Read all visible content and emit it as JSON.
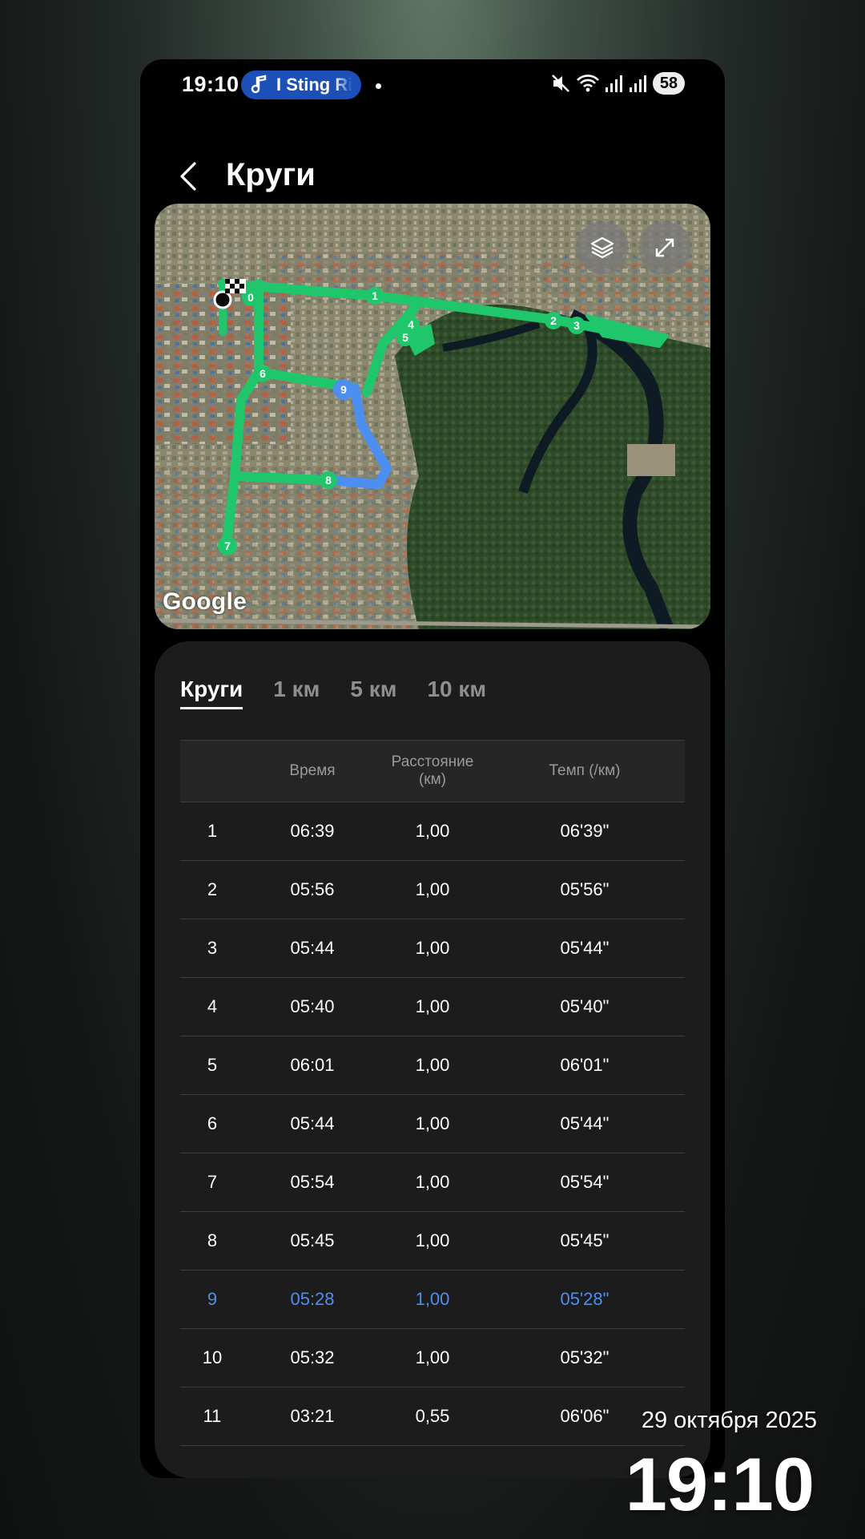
{
  "status_bar": {
    "time": "19:10",
    "media_text": "I Sting Ri",
    "battery": "58",
    "icons": [
      "mute-icon",
      "wifi-icon",
      "signal-icon",
      "signal-icon"
    ]
  },
  "header": {
    "title": "Круги"
  },
  "map": {
    "logo": "Google",
    "route_color": "#1fc66b",
    "highlight_color": "#4d8ff0",
    "markers": [
      "0",
      "1",
      "2",
      "3",
      "4",
      "5",
      "6",
      "7",
      "8",
      "9"
    ]
  },
  "tabs": [
    {
      "label": "Круги",
      "active": true
    },
    {
      "label": "1 км",
      "active": false
    },
    {
      "label": "5 км",
      "active": false
    },
    {
      "label": "10 км",
      "active": false
    }
  ],
  "table": {
    "headers": [
      "",
      "Время",
      "Расстояние (км)",
      "Темп (/км)"
    ],
    "rows": [
      [
        "1",
        "06:39",
        "1,00",
        "06'39\""
      ],
      [
        "2",
        "05:56",
        "1,00",
        "05'56\""
      ],
      [
        "3",
        "05:44",
        "1,00",
        "05'44\""
      ],
      [
        "4",
        "05:40",
        "1,00",
        "05'40\""
      ],
      [
        "5",
        "06:01",
        "1,00",
        "06'01\""
      ],
      [
        "6",
        "05:44",
        "1,00",
        "05'44\""
      ],
      [
        "7",
        "05:54",
        "1,00",
        "05'54\""
      ],
      [
        "8",
        "05:45",
        "1,00",
        "05'45\""
      ],
      [
        "9",
        "05:28",
        "1,00",
        "05'28\""
      ],
      [
        "10",
        "05:32",
        "1,00",
        "05'32\""
      ],
      [
        "11",
        "03:21",
        "0,55",
        "06'06\""
      ]
    ],
    "highlighted_row": 8
  },
  "lockscreen": {
    "date": "29 октября 2025",
    "time": "19:10"
  }
}
